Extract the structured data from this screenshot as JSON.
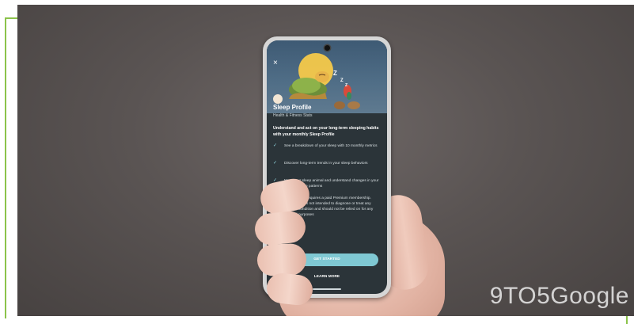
{
  "screen": {
    "close_glyph": "×",
    "title": "Sleep Profile",
    "subtitle": "Health & Fitness Stats",
    "intro": "Understand and act on your long-term sleeping habits with your monthly Sleep Profile",
    "features": [
      "See a breakdown of your sleep with 10 monthly metrics",
      "Discover long-term trends in your sleep behaviors",
      "Meet your sleep animal and understand changes in your monthly sleep patterns",
      "Sleep Profile requires a paid Premium membership. This feature is not intended to diagnose or treat any medical condition and should not be relied on for any medical purposes"
    ],
    "check_glyph": "✓",
    "cta_label": "GET STARTED",
    "learn_more_label": "LEARN MORE"
  },
  "illustration": {
    "sleep_letters": [
      "Z",
      "Z",
      "Z"
    ]
  },
  "watermark": "9TO5Google",
  "colors": {
    "frame_accent": "#8bc34a",
    "screen_bg": "#2b3439",
    "cta": "#7fc8d3"
  }
}
